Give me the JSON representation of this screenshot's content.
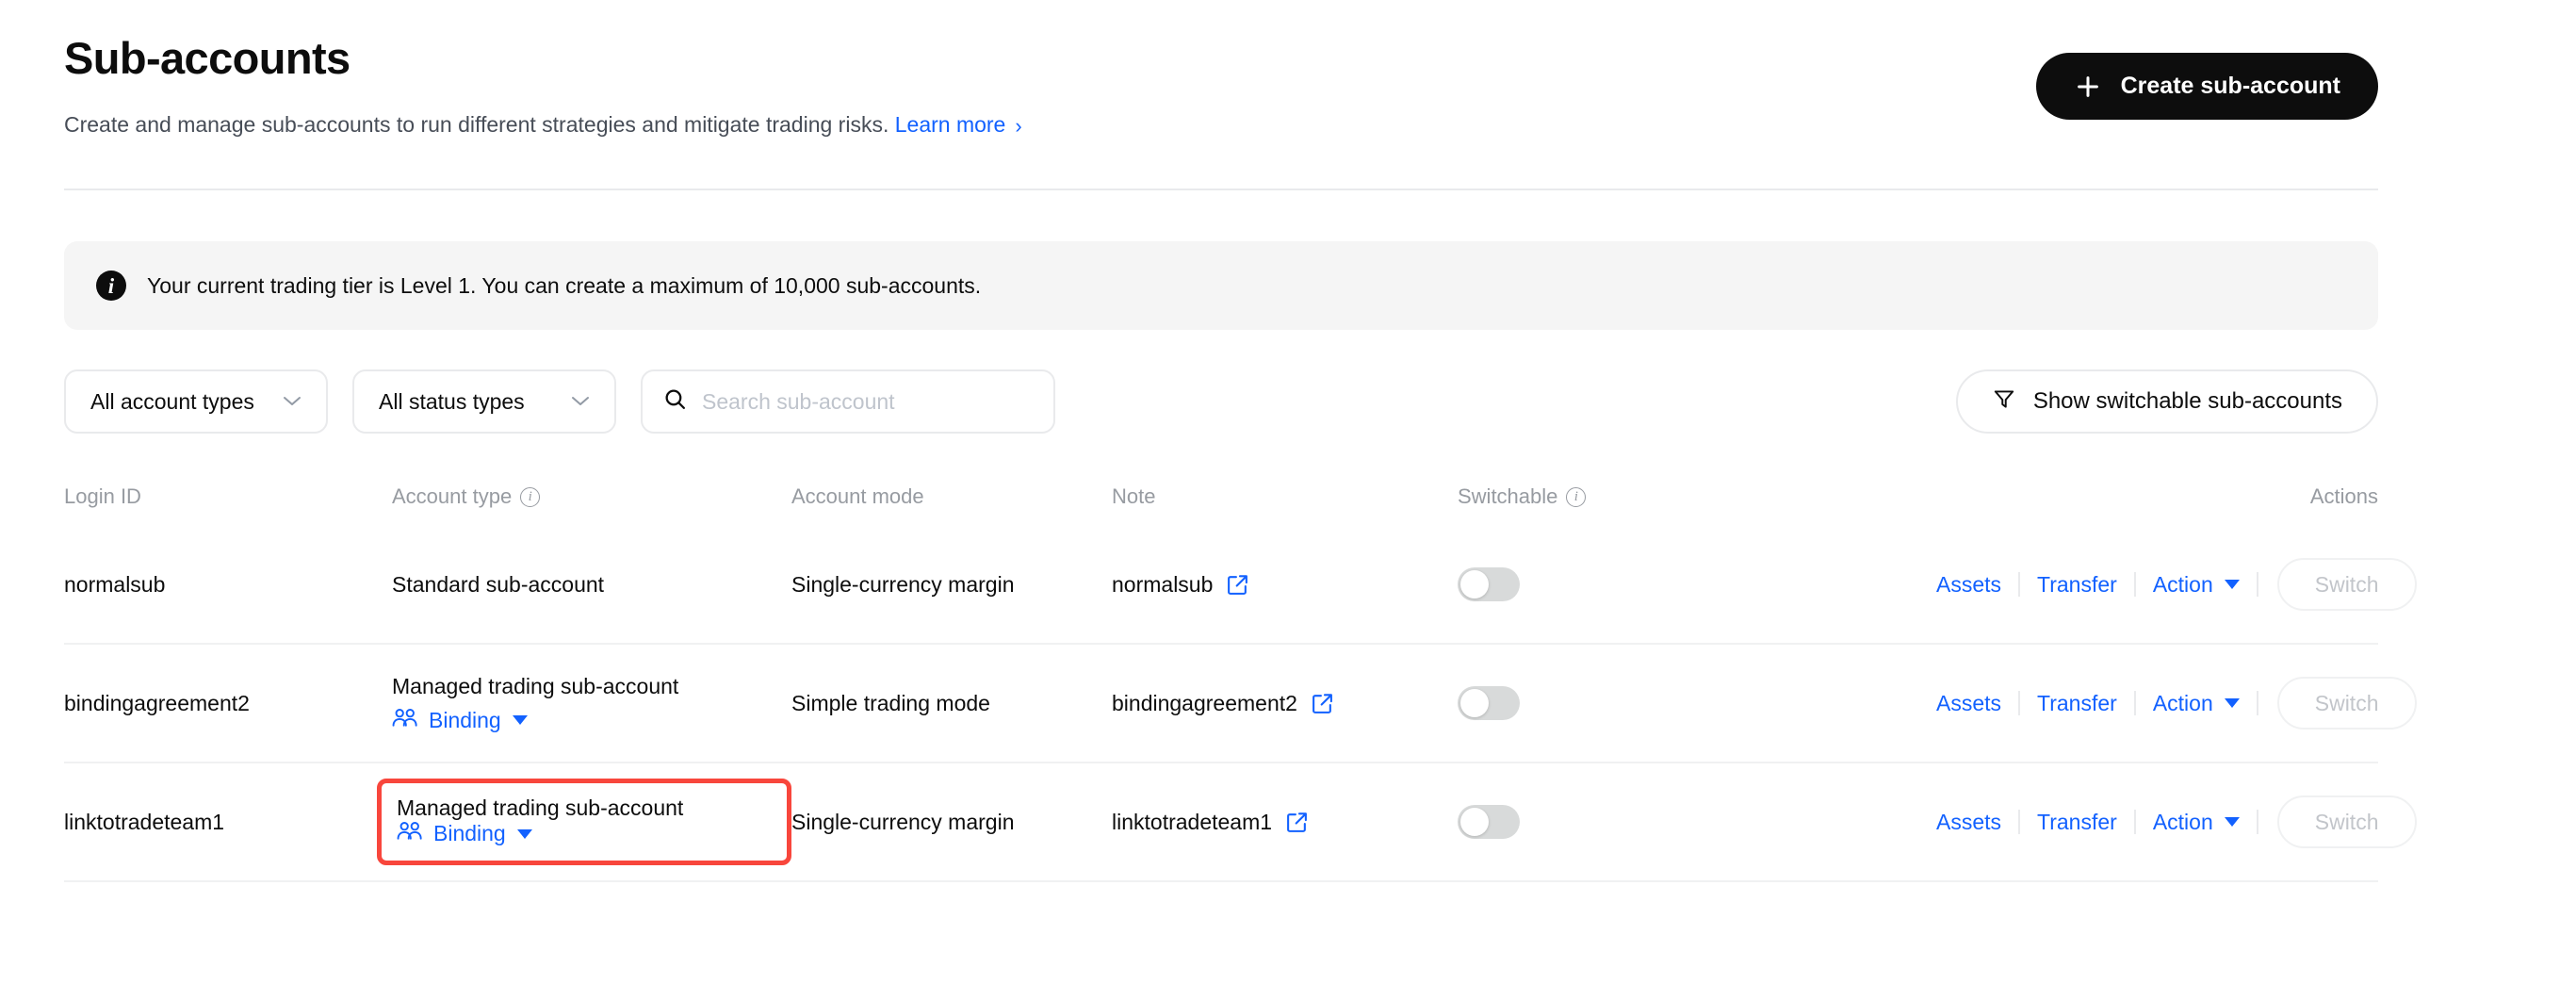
{
  "header": {
    "title": "Sub-accounts",
    "subtitle": "Create and manage sub-accounts to run different strategies and mitigate trading risks.",
    "learn_more": "Learn more",
    "chevron": "›",
    "create_button": "Create sub-account",
    "plus_icon": "plus-icon"
  },
  "banner": {
    "icon": "info-icon",
    "icon_glyph": "i",
    "text": "Your current trading tier is Level 1. You can create a maximum of 10,000 sub-accounts."
  },
  "filters": {
    "account_type": {
      "value": "All account types",
      "chevron": "∨"
    },
    "status_type": {
      "value": "All status types",
      "chevron": "∨"
    },
    "search": {
      "value": "",
      "placeholder": "Search sub-account",
      "icon": "search-icon"
    },
    "switchable_button": {
      "label": "Show switchable sub-accounts",
      "icon": "filter-funnel-icon"
    }
  },
  "table": {
    "headers": {
      "login_id": "Login ID",
      "account_type": "Account type",
      "account_mode": "Account mode",
      "note": "Note",
      "switchable": "Switchable",
      "actions": "Actions",
      "info_glyph": "i"
    },
    "rows": [
      {
        "login_id": "normalsub",
        "account_type": "Standard sub-account",
        "binding_label": null,
        "highlighted": false,
        "account_mode": "Single-currency margin",
        "note": "normalsub",
        "switchable_on": false,
        "actions": {
          "assets": "Assets",
          "transfer": "Transfer",
          "action": "Action",
          "switch": "Switch"
        }
      },
      {
        "login_id": "bindingagreement2",
        "account_type": "Managed trading sub-account",
        "binding_label": "Binding",
        "highlighted": false,
        "account_mode": "Simple trading mode",
        "note": "bindingagreement2",
        "switchable_on": false,
        "actions": {
          "assets": "Assets",
          "transfer": "Transfer",
          "action": "Action",
          "switch": "Switch"
        }
      },
      {
        "login_id": "linktotradeteam1",
        "account_type": "Managed trading sub-account",
        "binding_label": "Binding",
        "highlighted": true,
        "account_mode": "Single-currency margin",
        "note": "linktotradeteam1",
        "switchable_on": false,
        "actions": {
          "assets": "Assets",
          "transfer": "Transfer",
          "action": "Action",
          "switch": "Switch"
        }
      }
    ]
  },
  "colors": {
    "accent_link": "#1261ff",
    "primary_dark": "#0d0d0d",
    "highlight_red": "#f8463c",
    "muted_text": "#979ba1",
    "banner_bg": "#f5f5f5",
    "border": "#e9eaec"
  }
}
